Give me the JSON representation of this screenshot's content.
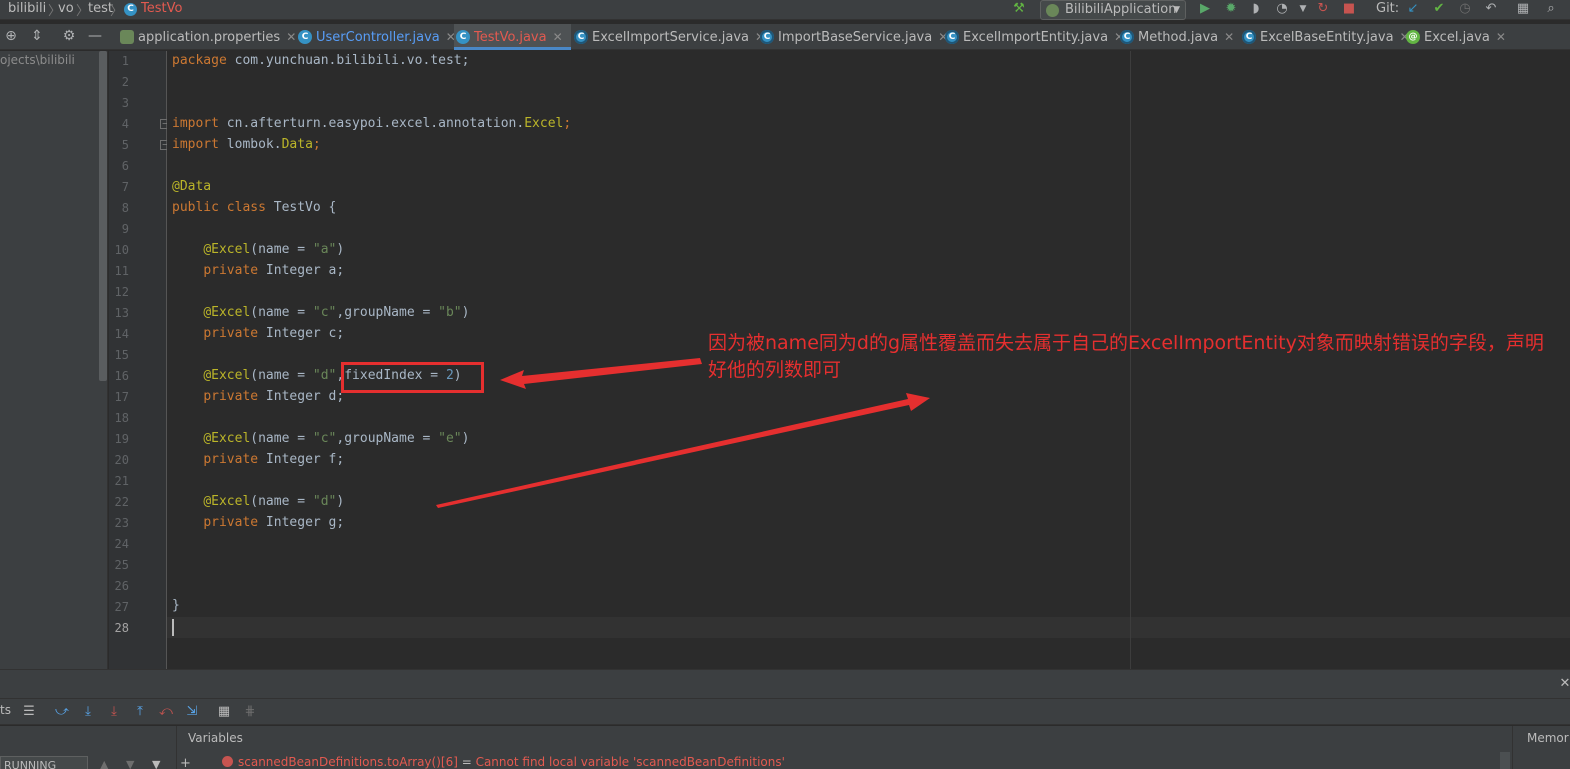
{
  "breadcrumbs": [
    "bilibili",
    "vo",
    "test",
    "TestVo"
  ],
  "run_config": {
    "label": "BilibiliApplication"
  },
  "git_label": "Git:",
  "tabs": [
    {
      "label": "application.properties",
      "icon": "properties-file-icon",
      "active": false
    },
    {
      "label": "UserController.java",
      "icon": "class-icon",
      "active": false
    },
    {
      "label": "TestVo.java",
      "icon": "class-icon",
      "active": true
    },
    {
      "label": "ExcelImportService.java",
      "icon": "readonly-class-icon",
      "active": false
    },
    {
      "label": "ImportBaseService.java",
      "icon": "readonly-class-icon",
      "active": false
    },
    {
      "label": "ExcelImportEntity.java",
      "icon": "readonly-class-icon",
      "active": false
    },
    {
      "label": "Method.java",
      "icon": "readonly-class-icon",
      "active": false
    },
    {
      "label": "ExcelBaseEntity.java",
      "icon": "readonly-class-icon",
      "active": false
    },
    {
      "label": "Excel.java",
      "icon": "annotation-icon",
      "active": false
    }
  ],
  "project_panel": {
    "path_text": "ojects\\bilibili"
  },
  "editor": {
    "line_numbers": [
      "1",
      "2",
      "3",
      "4",
      "5",
      "6",
      "7",
      "8",
      "9",
      "10",
      "11",
      "12",
      "13",
      "14",
      "15",
      "16",
      "17",
      "18",
      "19",
      "20",
      "21",
      "22",
      "23",
      "24",
      "25",
      "26",
      "27",
      "28"
    ],
    "current_line": 28,
    "code": {
      "l1_kw": "package",
      "l1_rest": " com.yunchuan.bilibili.vo.test;",
      "l4_kw": "import",
      "l4_rest": " cn.afterturn.easypoi.excel.annotation.",
      "l4_cls": "Excel",
      "l4_end": ";",
      "l5_kw": "import",
      "l5_rest": " lombok.",
      "l5_cls": "Data",
      "l5_end": ";",
      "l7": "@Data",
      "l8_kw": "public class",
      "l8_rest": " TestVo {",
      "l10_an": "@Excel",
      "l10_a": "(name = ",
      "l10_s": "\"a\"",
      "l10_b": ")",
      "l11_kw": "private",
      "l11_rest": " Integer a;",
      "l13_an": "@Excel",
      "l13_a": "(name = ",
      "l13_s1": "\"c\"",
      "l13_b": ",groupName = ",
      "l13_s2": "\"b\"",
      "l13_c": ")",
      "l14_kw": "private",
      "l14_rest": " Integer c;",
      "l16_an": "@Excel",
      "l16_a": "(name = ",
      "l16_s": "\"d\"",
      "l16_b": ",fixedIndex = ",
      "l16_n": "2",
      "l16_c": ")",
      "l17_kw": "private",
      "l17_rest": " Integer d;",
      "l19_an": "@Excel",
      "l19_a": "(name = ",
      "l19_s1": "\"c\"",
      "l19_b": ",groupName = ",
      "l19_s2": "\"e\"",
      "l19_c": ")",
      "l20_kw": "private",
      "l20_rest": " Integer f;",
      "l22_an": "@Excel",
      "l22_a": "(name = ",
      "l22_s": "\"d\"",
      "l22_b": ")",
      "l23_kw": "private",
      "l23_rest": " Integer g;",
      "l27": "}"
    }
  },
  "annotation": {
    "text": "因为被name同为d的g属性覆盖而失去属于自己的ExcelImportEntity对象而映射错误的字段，声明好他的列数即可",
    "color": "#e52f2f"
  },
  "debug": {
    "tools_label": "ts",
    "thread_select": "RUNNING",
    "variables_header": "Variables",
    "memory_label": "Memor",
    "variable_row": {
      "name": "scannedBeanDefinitions.toArray()[6]",
      "eq": " = ",
      "message": "Cannot find local variable 'scannedBeanDefinitions'"
    }
  },
  "colors": {
    "background": "#2b2b2b",
    "keyword": "#cc7832",
    "annotation": "#bbb529",
    "string": "#6a8759",
    "number": "#6897bb",
    "active_tab_text": "#e35a50"
  }
}
